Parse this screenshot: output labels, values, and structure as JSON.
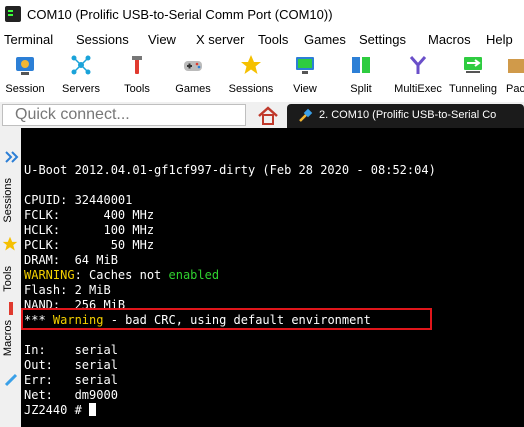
{
  "window": {
    "title": "COM10  (Prolific USB-to-Serial Comm Port (COM10))"
  },
  "menu": [
    "Terminal",
    "Sessions",
    "View",
    "X server",
    "Tools",
    "Games",
    "Settings",
    "Macros",
    "Help"
  ],
  "toolbar": [
    {
      "label": "Session",
      "icon": "session-icon"
    },
    {
      "label": "Servers",
      "icon": "servers-icon"
    },
    {
      "label": "Tools",
      "icon": "tools-icon"
    },
    {
      "label": "Games",
      "icon": "games-icon"
    },
    {
      "label": "Sessions",
      "icon": "star-icon"
    },
    {
      "label": "View",
      "icon": "view-icon"
    },
    {
      "label": "Split",
      "icon": "split-icon"
    },
    {
      "label": "MultiExec",
      "icon": "multiexec-icon"
    },
    {
      "label": "Tunneling",
      "icon": "tunneling-icon"
    },
    {
      "label": "Pac",
      "icon": "packages-icon"
    }
  ],
  "quick_connect": {
    "placeholder": "Quick connect..."
  },
  "tabs": {
    "active_label": "2. COM10  (Prolific USB-to-Serial Co"
  },
  "sidebar": {
    "labels": [
      "Sessions",
      "Tools",
      "Macros"
    ]
  },
  "terminal": {
    "banner": "U-Boot 2012.04.01-gf1cf997-dirty (Feb 28 2020 - 08:52:04)",
    "cpuid": "CPUID: 32440001",
    "fclk": "FCLK:      400 MHz",
    "hclk": "HCLK:      100 MHz",
    "pclk": "PCLK:       50 MHz",
    "dram": "DRAM:  64 MiB",
    "warn_prefix": "WARNING",
    "warn_mid": ": Caches not ",
    "warn_state": "enabled",
    "flash": "Flash: 2 MiB",
    "nand": "NAND:  256 MiB",
    "crc_stars": "*** ",
    "crc_word": "Warning",
    "crc_rest": " - bad CRC, using default environment",
    "in": "In:    serial",
    "out": "Out:   serial",
    "err": "Err:   serial",
    "net": "Net:   dm9000",
    "prompt": "JZ2440 # "
  },
  "colors": {
    "terminal_bg": "#000000",
    "warning_yellow": "#f4d000",
    "enabled_green": "#2fd12f",
    "annotation_red": "#e0161b",
    "tab_dark": "#1b1b1b"
  }
}
